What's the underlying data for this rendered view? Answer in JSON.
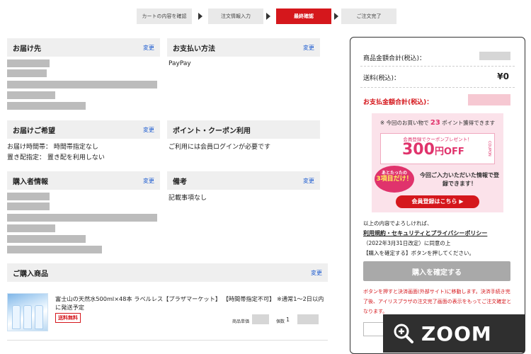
{
  "steps": [
    {
      "label": "カートの内容を確認"
    },
    {
      "label": "注文情報入力"
    },
    {
      "label": "最終確認"
    },
    {
      "label": "ご注文完了"
    }
  ],
  "sections": {
    "delivery_address": {
      "title": "お届け先",
      "change": "変更"
    },
    "payment": {
      "title": "お支払い方法",
      "change": "変更",
      "value": "PayPay"
    },
    "delivery_wish": {
      "title": "お届けご希望",
      "change": "変更",
      "line1": "お届け時間帯： 時間帯指定なし",
      "line2": "置き配指定： 置き配を利用しない"
    },
    "points": {
      "title": "ポイント・クーポン利用",
      "value": "ご利用には会員ログインが必要です"
    },
    "buyer": {
      "title": "購入者情報",
      "change": "変更"
    },
    "notes": {
      "title": "備考",
      "change": "変更",
      "value": "記載事項なし"
    },
    "products": {
      "title": "ご購入商品",
      "change": "変更"
    }
  },
  "product": {
    "name": "富士山の天然水500ml×48本 ラベルレス【プラザマーケット】 【時間帯指定不可】 ※通常1〜2日以内に発送予定",
    "badge": "送料無料",
    "unit_price_label": "商品単価",
    "qty_label": "個数",
    "qty": "1"
  },
  "summary": {
    "subtotal_label": "商品金額合計(税込)：",
    "shipping_label": "送料(税込)：",
    "shipping_value": "¥0",
    "total_label": "お支払金額合計(税込)：",
    "banner": {
      "top_prefix": "※ 今回のお買い物で",
      "points": "23",
      "top_suffix": "ポイント獲得できます",
      "coupon_head": "会員登録でクーポンプレゼント！",
      "coupon_amount": "300",
      "coupon_unit": "円OFF",
      "coupon_tag": "COUPON",
      "circle_line1": "あとたったの",
      "circle_line2": "3項目だけ！",
      "message": "今回ご入力いただいた情報で登録できます！",
      "button": "会員登録はこちら ▶"
    },
    "agree_line1": "以上の内容でよろしければ、",
    "agree_link": "利用規約・セキュリティとプライバシーポリシー",
    "agree_line2": "（2022年3月31日改定）に同意の上",
    "agree_line3": "【購入を確定する】ボタンを押してください。",
    "confirm_button": "購入を確定する",
    "warning": "ボタンを押すと決済画面(外部サイト)に移動します。決済手続き完了後、アイリスプラザの注文完了画面の表示をもってご注文確定となります。"
  },
  "zoom": {
    "label": "ZOOM",
    "icon": "zoom-in-icon"
  },
  "colors": {
    "accent": "#d5171c",
    "link": "#1a5ad0",
    "header_bg": "#efefef",
    "banner_pink": "#e0336c"
  }
}
